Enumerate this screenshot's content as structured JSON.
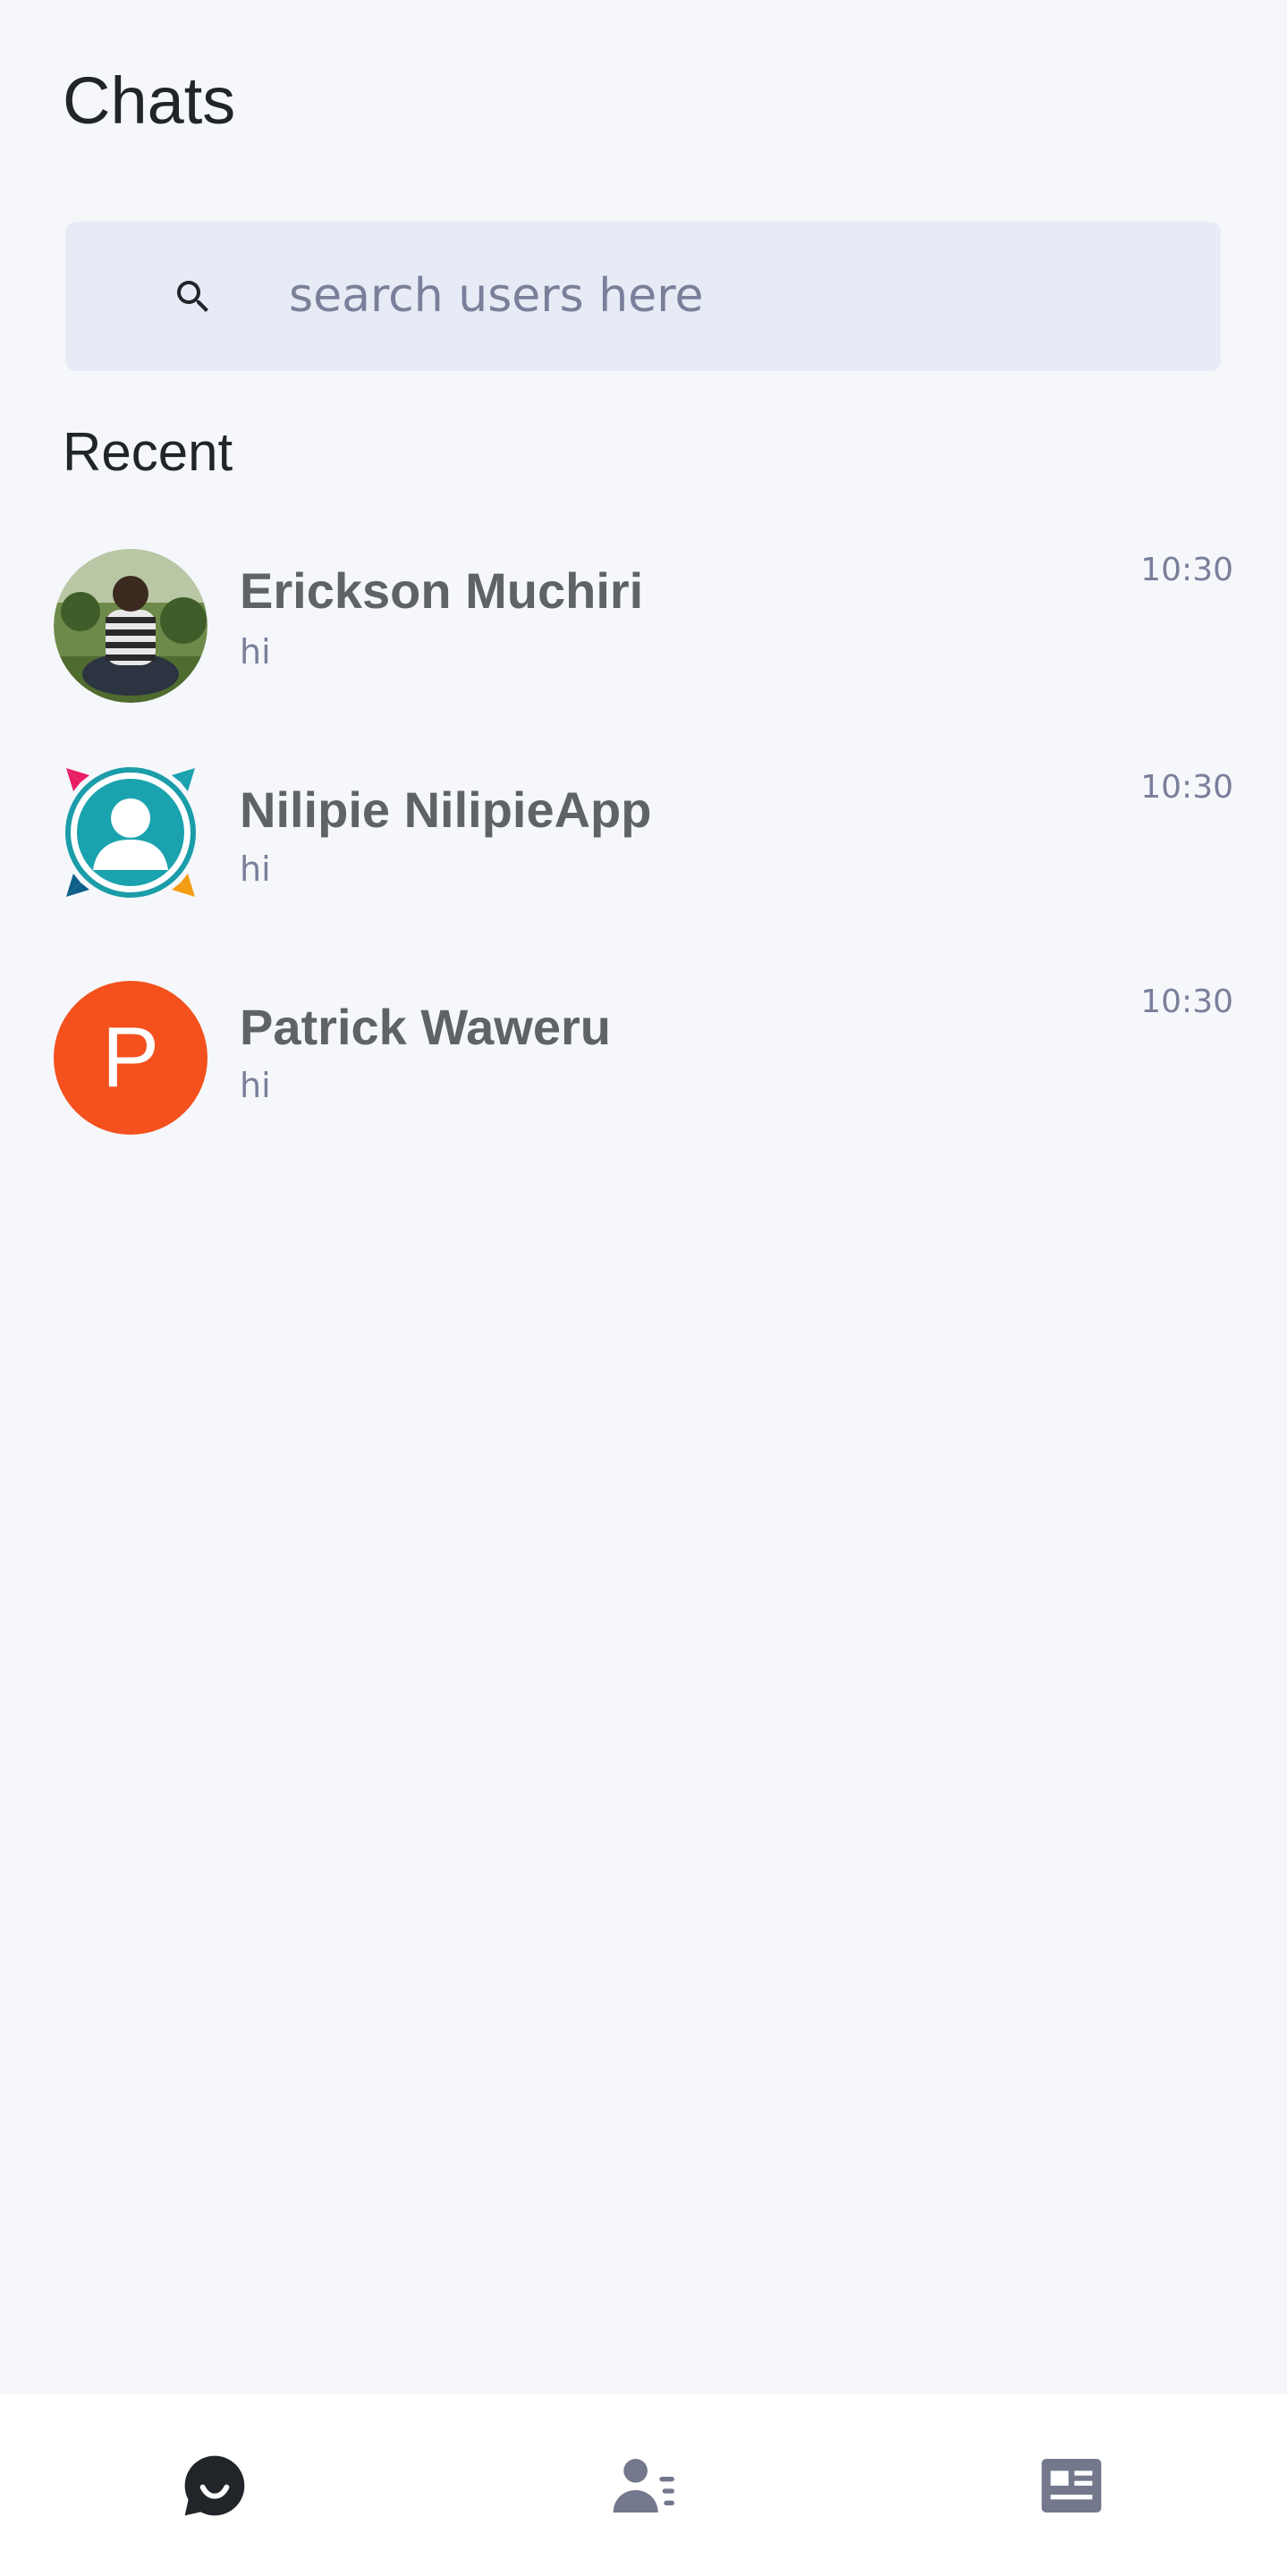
{
  "header": {
    "title": "Chats"
  },
  "search": {
    "placeholder": "search users here",
    "value": ""
  },
  "recent": {
    "title": "Recent",
    "chats": [
      {
        "name": "Erickson Muchiri",
        "preview": "hi",
        "time": "10:30",
        "avatar": "photo"
      },
      {
        "name": "Nilipie NilipieApp",
        "preview": "hi",
        "time": "10:30",
        "avatar": "app-logo"
      },
      {
        "name": "Patrick Waweru",
        "preview": "hi",
        "time": "10:30",
        "avatar": "letter",
        "avatar_letter": "P"
      }
    ]
  },
  "bottom_nav": {
    "items": [
      {
        "icon": "chat-icon",
        "active": true
      },
      {
        "icon": "contacts-icon",
        "active": false
      },
      {
        "icon": "news-icon",
        "active": false
      }
    ]
  },
  "colors": {
    "background": "#f5f7fb",
    "search_bg": "#e6ebf5",
    "text_primary": "#212529",
    "text_name": "#5f6368",
    "text_muted": "#7a7f9a",
    "letter_avatar_bg": "#f4511e",
    "nav_active": "#212529",
    "nav_inactive": "#74788d"
  }
}
